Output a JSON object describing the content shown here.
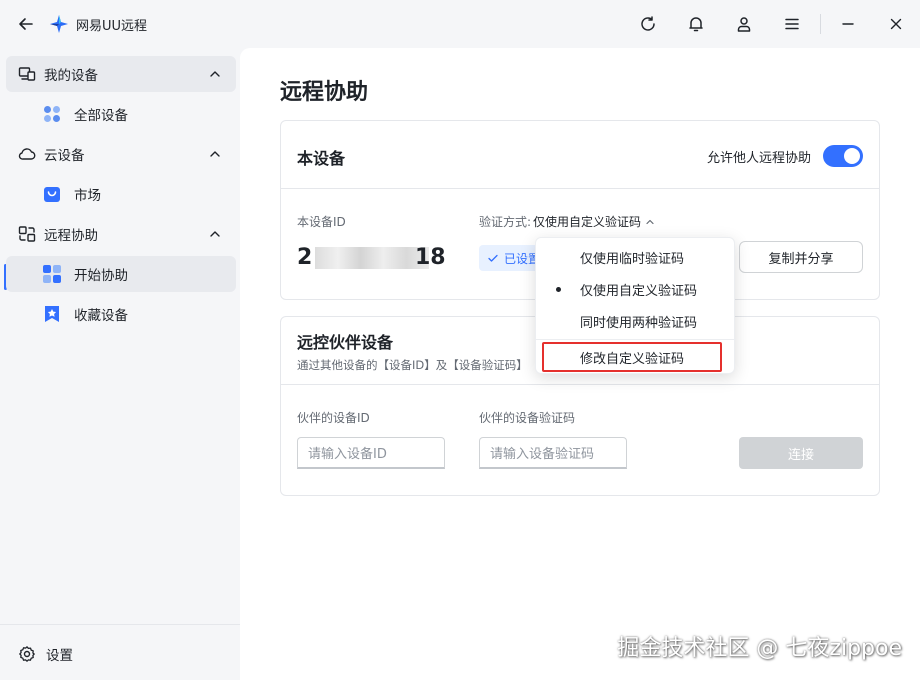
{
  "app": {
    "title": "网易UU远程"
  },
  "sidebar": {
    "groups": [
      {
        "label": "我的设备",
        "items": [
          {
            "label": "全部设备"
          }
        ]
      },
      {
        "label": "云设备",
        "items": [
          {
            "label": "市场"
          }
        ]
      },
      {
        "label": "远程协助",
        "items": [
          {
            "label": "开始协助"
          },
          {
            "label": "收藏设备"
          }
        ]
      }
    ],
    "settings_label": "设置"
  },
  "main": {
    "page_title": "远程协助",
    "this_device": {
      "title": "本设备",
      "allow_label": "允许他人远程协助",
      "allow_enabled": true,
      "device_id_label": "本设备ID",
      "device_id_prefix": "2",
      "device_id_suffix": "18",
      "verify_mode_label": "验证方式:",
      "verify_mode_value": "仅使用自定义验证码",
      "set_badge": "已设置",
      "copy_share_label": "复制并分享"
    },
    "partner": {
      "title": "远控伙伴设备",
      "subtitle": "通过其他设备的【设备ID】及【设备验证码】",
      "partner_id_label": "伙伴的设备ID",
      "partner_id_placeholder": "请输入设备ID",
      "partner_code_label": "伙伴的设备验证码",
      "partner_code_placeholder": "请输入设备验证码",
      "connect_label": "连接"
    }
  },
  "dropdown": {
    "items": [
      {
        "label": "仅使用临时验证码",
        "selected": false
      },
      {
        "label": "仅使用自定义验证码",
        "selected": true
      },
      {
        "label": "同时使用两种验证码",
        "selected": false
      }
    ],
    "action_label": "修改自定义验证码"
  },
  "watermark": "掘金技术社区 @ 七夜zippoe",
  "colors": {
    "accent": "#3370ff",
    "highlight": "#e5302d"
  }
}
